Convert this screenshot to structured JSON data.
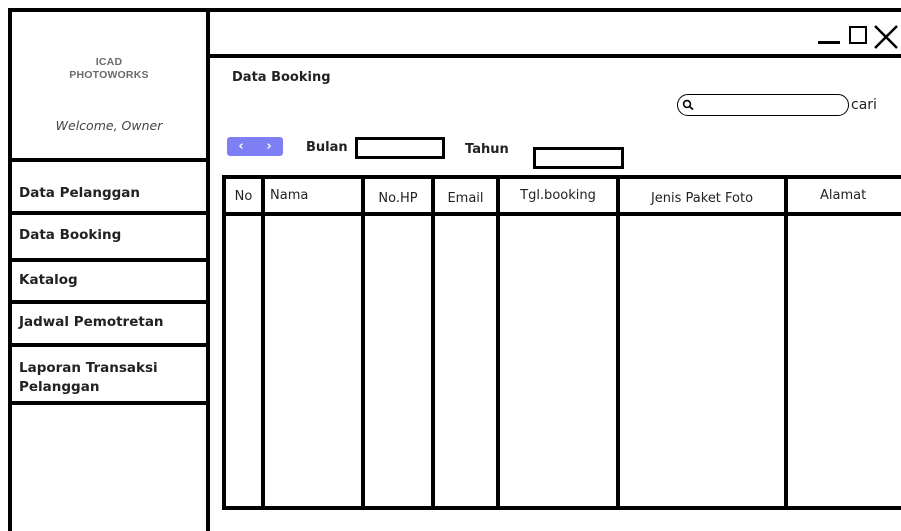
{
  "sidebar": {
    "brand_line1": "ICAD",
    "brand_line2": "PHOTOWORKS",
    "welcome": "Welcome, Owner",
    "items": [
      {
        "label": "Data Pelanggan"
      },
      {
        "label": "Data Booking"
      },
      {
        "label": "Katalog"
      },
      {
        "label": "Jadwal Pemotretan"
      },
      {
        "label": "Laporan Transaksi",
        "label2": "Pelanggan"
      }
    ]
  },
  "main": {
    "title": "Data Booking",
    "search": {
      "button_label": "cari",
      "value": ""
    },
    "pager": {
      "prev": "‹",
      "next": "›"
    },
    "filters": {
      "bulan_label": "Bulan",
      "tahun_label": "Tahun"
    },
    "table": {
      "columns": [
        "No",
        "Nama",
        "No.HP",
        "Email",
        "Tgl.booking",
        "Jenis Paket Foto",
        "Alamat"
      ],
      "rows": []
    }
  },
  "icons": {
    "minimize": "minimize-icon",
    "maximize": "maximize-icon",
    "close": "close-icon",
    "search": "search-icon"
  },
  "colors": {
    "pager": "#7e7ef5",
    "border": "#000000"
  }
}
